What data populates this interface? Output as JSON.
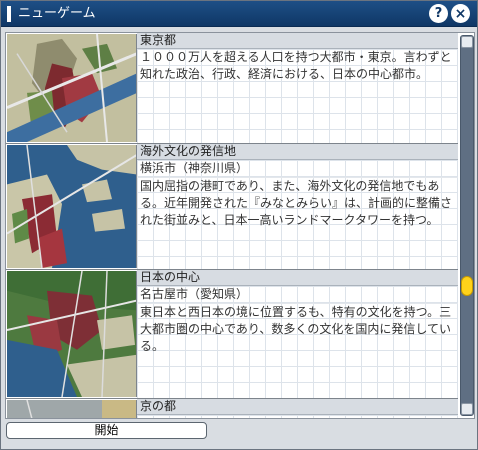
{
  "window": {
    "title": "ニューゲーム",
    "help_label": "?",
    "close_label": "×"
  },
  "entries": [
    {
      "title": "東京都",
      "subtitle": "",
      "description": "１０００万人を超える人口を持つ大都市・東京。言わずと知れた政治、行政、経済における、日本の中心都市。",
      "thumbnail_icon": "tokyo-map-thumbnail"
    },
    {
      "title": "海外文化の発信地",
      "subtitle": "横浜市（神奈川県）",
      "description": "国内屈指の港町であり、また、海外文化の発信地でもある。近年開発された『みなとみらい』は、計画的に整備された街並みと、日本一高いランドマークタワーを持つ。",
      "thumbnail_icon": "yokohama-map-thumbnail"
    },
    {
      "title": "日本の中心",
      "subtitle": "名古屋市（愛知県）",
      "description": "東日本と西日本の境に位置するも、特有の文化を持つ。三大都市圏の中心であり、数多くの文化を国内に発信している。",
      "thumbnail_icon": "nagoya-map-thumbnail"
    },
    {
      "title": "京の都",
      "subtitle": "",
      "description": "",
      "thumbnail_icon": "kyoto-map-thumbnail"
    }
  ],
  "scrollbar": {
    "position": 0.68
  },
  "footer": {
    "start_label": "開始"
  }
}
